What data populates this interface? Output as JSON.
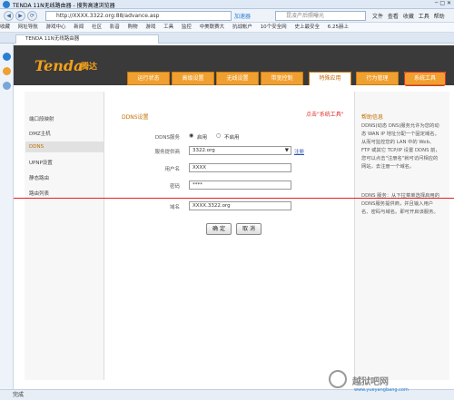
{
  "browser": {
    "title": "TENDA 11N无线路由器 - 搜狗高速浏览器",
    "window_controls": "─ □ ✕",
    "url": "http://XXXX.3322.org:88/advance.asp",
    "accelerate": "加速器",
    "search_placeholder": "昆凌产后照曝光",
    "menu": "文件 查看 收藏 工具 帮助",
    "favorites": [
      "收藏",
      "网址导航",
      "游戏中心",
      "新闻",
      "社区",
      "影音",
      "购物",
      "游戏",
      "工具",
      "监控",
      "中美联赛大",
      "抗战帐户",
      "10个安全网",
      "史上最安全",
      "6.25赫上"
    ],
    "tab_label": "TENDA 11N无线路由器",
    "status": "完成"
  },
  "router": {
    "brand": "Tenda",
    "brand_cn": "腾达",
    "nav_tabs": [
      "运行状态",
      "高级设置",
      "无线设置",
      "带宽控制",
      "特殊应用",
      "行为管理",
      "系统工具"
    ],
    "callout": "点击\"系统工具\"",
    "side_menu": [
      "端口段映射",
      "DMZ主机",
      "DDNS",
      "UPNP设置",
      "静态路由",
      "路由列表"
    ],
    "form": {
      "heading": "DDNS设置",
      "service_label": "DDNS服务",
      "enable": "启用",
      "disable": "不启用",
      "provider_label": "服务提供商",
      "provider_value": "3322.org",
      "register": "注册",
      "user_label": "用户名",
      "user_value": "XXXX",
      "password_label": "密码",
      "password_value": "****",
      "domain_label": "域名",
      "domain_value": "XXXX.3322.org",
      "ok": "确 定",
      "cancel": "取 消"
    },
    "help": {
      "title": "帮助信息",
      "p1": "DDNS(动态 DNS)服务允许为您的动态 WAN IP 地址分配一个固定域名。从而可监控您的 LAN 中的 Web、FTP 或其它 TCP/IP 设置 DDNS 前，您可以点击\"注册名\"就可访问相应的网站，去注册一个域名。",
      "p2": "DDNS 服务：从下拉菜单选择启用的DDNS服务提供商，并且输入用户名、密码与域名。即可开启该服务。"
    }
  },
  "watermark": {
    "text": "越狱吧网",
    "url": "www.yueyangbang.com"
  },
  "colors": {
    "accent": "#f0a030",
    "header": "#3a3a3a",
    "callout": "#e03030"
  }
}
